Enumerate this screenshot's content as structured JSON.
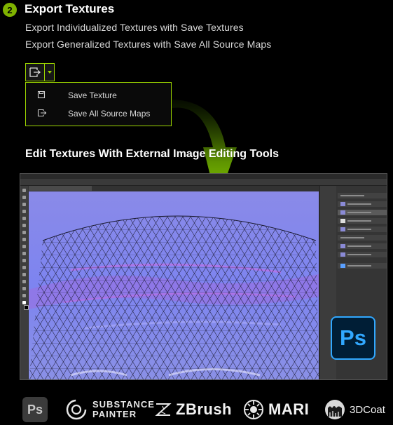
{
  "section": {
    "step_number": "2",
    "title": "Export Textures",
    "lines": [
      "Export Individualized Textures with Save Textures",
      "Export Generalized Textures with Save All Source Maps"
    ]
  },
  "export_menu": {
    "items": [
      {
        "label": "Save Texture",
        "icon": "save-icon"
      },
      {
        "label": "Save All Source Maps",
        "icon": "export-icon"
      }
    ]
  },
  "subtitle": "Edit Textures With External Image Editing Tools",
  "photoshop_badge": "Ps",
  "logos": {
    "photoshop": "Ps",
    "substance_line1": "SUBSTANCE",
    "substance_line2": "PAINTER",
    "zbrush": "ZBrush",
    "mari": "MARI",
    "coat": "3DCoat"
  },
  "colors": {
    "accent_green": "#9bd400",
    "photoshop_blue": "#31a8ff",
    "normal_map": "#8a8ae8"
  }
}
